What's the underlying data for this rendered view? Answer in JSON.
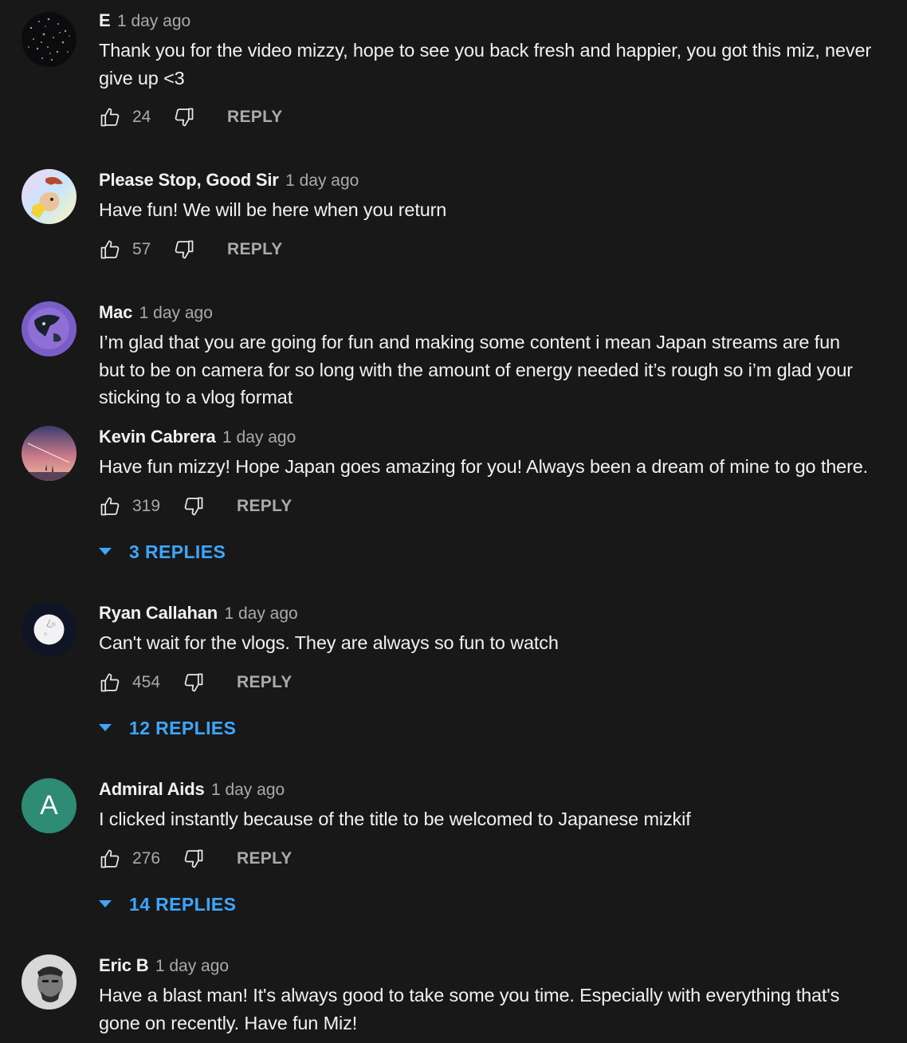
{
  "comments": [
    {
      "author": "E",
      "time": "1 day ago",
      "lines": [
        "Thank you for the video mizzy, hope to see you back fresh and happier, you got this miz, never",
        "give up <3"
      ],
      "likes": "24",
      "reply_label": "REPLY",
      "avatar": "galaxy-avatar"
    },
    {
      "author": "Please Stop, Good Sir",
      "time": "1 day ago",
      "lines": [
        "Have fun! We will be here when you return"
      ],
      "likes": "57",
      "reply_label": "REPLY",
      "avatar": "cartoon-avatar"
    },
    {
      "author": "Mac",
      "time": "1 day ago",
      "lines": [
        "I’m glad that you are going for fun and making some content i mean Japan streams are fun",
        "but to be on camera for so long with the amount of energy needed it’s rough so i’m glad your",
        "sticking to a vlog format"
      ],
      "likes": "",
      "reply_label": "",
      "avatar": "figure-avatar"
    },
    {
      "author": "Kevin Cabrera",
      "time": "1 day ago",
      "lines": [
        "Have fun mizzy! Hope Japan goes amazing for you! Always been a dream of mine to go there."
      ],
      "likes": "319",
      "reply_label": "REPLY",
      "replies": "3 REPLIES",
      "avatar": "sky-avatar"
    },
    {
      "author": "Ryan Callahan",
      "time": "1 day ago",
      "lines": [
        "Can't wait for the vlogs. They are always so fun to watch"
      ],
      "likes": "454",
      "reply_label": "REPLY",
      "replies": "12 REPLIES",
      "avatar": "moon-avatar"
    },
    {
      "author": "Admiral Aids",
      "time": "1 day ago",
      "lines": [
        "I clicked instantly because of the title to be welcomed to Japanese mizkif"
      ],
      "likes": "276",
      "reply_label": "REPLY",
      "replies": "14 REPLIES",
      "avatar_letter": "A",
      "avatar_color": "#2e8b74"
    },
    {
      "author": "Eric B",
      "time": "1 day ago",
      "lines": [
        "Have a blast man! It's always good to take some you time. Especially with everything that's",
        "gone on recently. Have fun Miz!"
      ],
      "likes": "",
      "reply_label": "",
      "avatar": "photo-avatar"
    }
  ],
  "colors": {
    "background": "#181818",
    "text": "#f1f1f1",
    "secondary": "#aaaaaa",
    "link": "#3ea6ff"
  }
}
